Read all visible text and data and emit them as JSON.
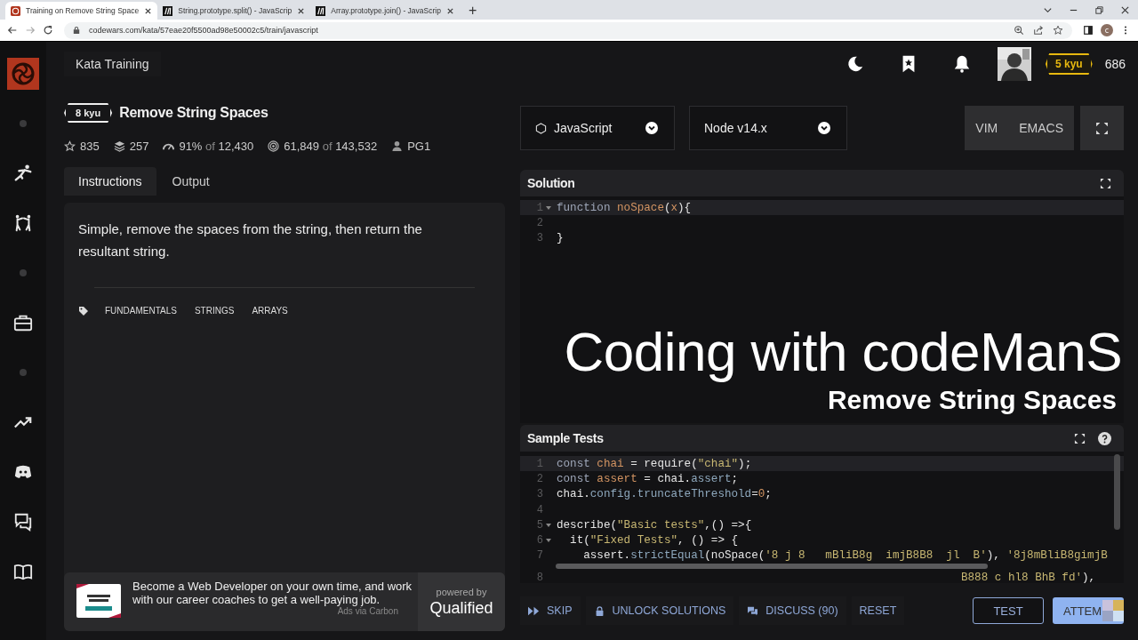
{
  "browser": {
    "tabs": [
      {
        "title": "Training on Remove String Space",
        "selected": true
      },
      {
        "title": "String.prototype.split() - JavaScrip",
        "selected": false
      },
      {
        "title": "Array.prototype.join() - JavaScrip",
        "selected": false
      }
    ],
    "new_tab": "+",
    "url": "codewars.com/kata/57eae20f5500ad98e50002c5/train/javascript",
    "profile_initial": "c"
  },
  "sidebar": {
    "items": [
      {
        "kind": "logo"
      },
      {
        "kind": "dot"
      },
      {
        "kind": "kata"
      },
      {
        "kind": "dojo"
      },
      {
        "kind": "dot"
      },
      {
        "kind": "work"
      },
      {
        "kind": "dot"
      },
      {
        "kind": "trend"
      },
      {
        "kind": "discord"
      },
      {
        "kind": "chat"
      },
      {
        "kind": "docs"
      }
    ]
  },
  "header": {
    "title": "Kata Training",
    "rank": "5 kyu",
    "honor": "686"
  },
  "kata": {
    "rank": "8 kyu",
    "title": "Remove String Spaces",
    "stats": [
      {
        "kind": "stars",
        "value": "835"
      },
      {
        "kind": "collections",
        "value": "257"
      },
      {
        "kind": "satisfaction",
        "value": "91%",
        "joiner": "of",
        "total": "12,430"
      },
      {
        "kind": "completed",
        "value": "61,849",
        "joiner": "of",
        "total": "143,532"
      },
      {
        "kind": "author",
        "value": "PG1"
      }
    ],
    "tabs": [
      {
        "label": "Instructions",
        "selected": true
      },
      {
        "label": "Output",
        "selected": false
      }
    ],
    "description": "Simple, remove the spaces from the string, then return the resultant string.",
    "tags": [
      "FUNDAMENTALS",
      "STRINGS",
      "ARRAYS"
    ]
  },
  "ad": {
    "text": "Become a Web Developer on your own time, and work with our career coaches to get a well-paying job.",
    "attribution": "Ads via Carbon",
    "powered_by": "powered by",
    "brand": "Qualified"
  },
  "editor": {
    "language": "JavaScript",
    "version": "Node v14.x",
    "modes": [
      "VIM",
      "EMACS"
    ],
    "solution": {
      "title": "Solution",
      "lines": [
        {
          "number": "1",
          "foldable": true,
          "active": true,
          "tokens": [
            {
              "kind": "keyword",
              "text": "function "
            },
            {
              "kind": "name",
              "text": "noSpace"
            },
            {
              "kind": "plain",
              "text": "("
            },
            {
              "kind": "name",
              "text": "x"
            },
            {
              "kind": "plain",
              "text": "){"
            }
          ]
        },
        {
          "number": "2",
          "foldable": false,
          "active": false
        },
        {
          "number": "3",
          "foldable": false,
          "active": false,
          "tokens": [
            {
              "kind": "plain",
              "text": "}"
            }
          ]
        }
      ]
    },
    "overlay": {
      "title": "Coding with codeManS",
      "subtitle": "Remove String Spaces"
    },
    "tests": {
      "title": "Sample Tests",
      "lines": [
        {
          "number": "1",
          "foldable": false,
          "active": true,
          "tokens": [
            {
              "kind": "keyword",
              "text": "const "
            },
            {
              "kind": "name",
              "text": "chai"
            },
            {
              "kind": "plain",
              "text": " = require("
            },
            {
              "kind": "string",
              "text": "\"chai\""
            },
            {
              "kind": "plain",
              "text": ");"
            }
          ]
        },
        {
          "number": "2",
          "foldable": false,
          "active": false,
          "tokens": [
            {
              "kind": "keyword",
              "text": "const "
            },
            {
              "kind": "name",
              "text": "assert"
            },
            {
              "kind": "plain",
              "text": " = chai."
            },
            {
              "kind": "prop",
              "text": "assert"
            },
            {
              "kind": "plain",
              "text": ";"
            }
          ]
        },
        {
          "number": "3",
          "foldable": false,
          "active": false,
          "tokens": [
            {
              "kind": "plain",
              "text": "chai."
            },
            {
              "kind": "prop",
              "text": "config.truncateThreshold"
            },
            {
              "kind": "plain",
              "text": "="
            },
            {
              "kind": "number",
              "text": "0"
            },
            {
              "kind": "plain",
              "text": ";"
            }
          ]
        },
        {
          "number": "4",
          "foldable": false,
          "active": false
        },
        {
          "number": "5",
          "foldable": true,
          "active": false,
          "tokens": [
            {
              "kind": "plain",
              "text": "describe("
            },
            {
              "kind": "string",
              "text": "\"Basic tests\""
            },
            {
              "kind": "plain",
              "text": ",() =>{"
            }
          ]
        },
        {
          "number": "6",
          "foldable": true,
          "active": false,
          "tokens": [
            {
              "kind": "plain",
              "text": "  it("
            },
            {
              "kind": "string",
              "text": "\"Fixed Tests\""
            },
            {
              "kind": "plain",
              "text": ", () => {"
            }
          ]
        },
        {
          "number": "7",
          "foldable": false,
          "active": false,
          "tokens": [
            {
              "kind": "plain",
              "text": "    assert."
            },
            {
              "kind": "prop",
              "text": "strictEqual"
            },
            {
              "kind": "plain",
              "text": "(noSpace("
            },
            {
              "kind": "string",
              "text": "'8 j 8   mBliB8g  imjB8B8  jl  B'"
            },
            {
              "kind": "plain",
              "text": "), "
            },
            {
              "kind": "string",
              "text": "'8j8mBliB8gimjB"
            }
          ]
        },
        {
          "number": "8",
          "foldable": false,
          "active": false,
          "tokens": [
            {
              "kind": "string",
              "text": "B888 c hl8 BhB fd'"
            },
            {
              "kind": "plain",
              "text": "),"
            }
          ]
        }
      ]
    },
    "actions": [
      {
        "kind": "skip",
        "label": "SKIP"
      },
      {
        "kind": "unlock",
        "label": "UNLOCK SOLUTIONS"
      },
      {
        "kind": "discuss",
        "label": "DISCUSS (90)"
      },
      {
        "kind": "reset",
        "label": "RESET"
      }
    ],
    "test_button": "TEST",
    "attempt_button": "ATTEM"
  }
}
